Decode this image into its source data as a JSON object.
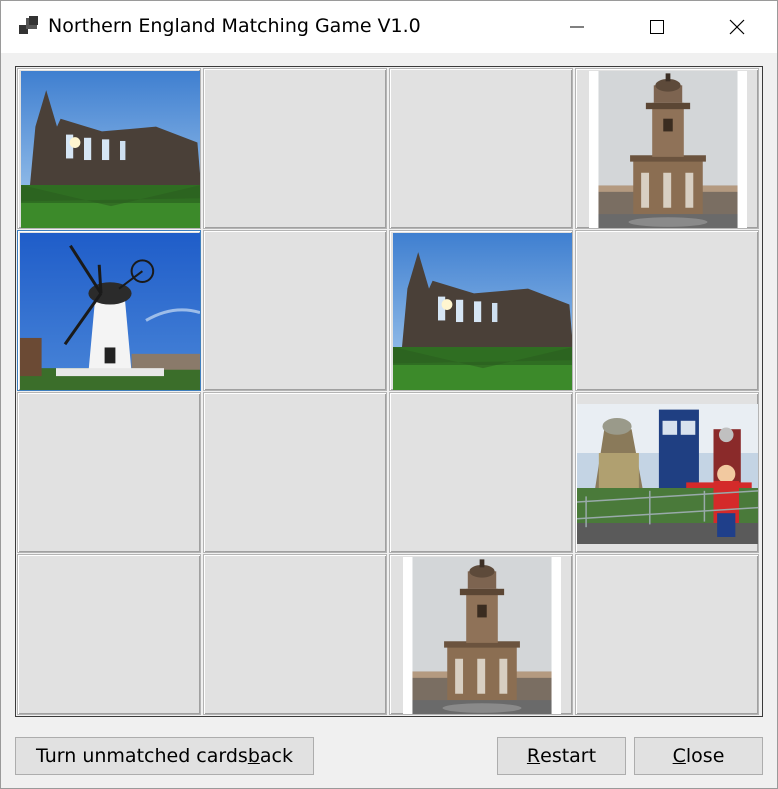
{
  "window": {
    "title": "Northern England Matching Game V1.0",
    "controls": [
      "minimize",
      "maximize",
      "close"
    ]
  },
  "board": {
    "cards": [
      {
        "image": "abbey-ruins",
        "face_up": true,
        "selected": false
      },
      {
        "image": null,
        "face_up": false
      },
      {
        "image": null,
        "face_up": false
      },
      {
        "image": "lighthouse",
        "face_up": true,
        "selected": false
      },
      {
        "image": "windmill",
        "face_up": true,
        "selected": true
      },
      {
        "image": null,
        "face_up": false
      },
      {
        "image": "abbey-ruins",
        "face_up": true,
        "selected": false
      },
      {
        "image": null,
        "face_up": false
      },
      {
        "image": null,
        "face_up": false
      },
      {
        "image": null,
        "face_up": false
      },
      {
        "image": null,
        "face_up": false
      },
      {
        "image": "daleks-tardis",
        "face_up": true,
        "selected": false
      },
      {
        "image": null,
        "face_up": false
      },
      {
        "image": null,
        "face_up": false
      },
      {
        "image": "lighthouse",
        "face_up": true,
        "selected": false
      },
      {
        "image": null,
        "face_up": false
      }
    ]
  },
  "buttons": {
    "turn_back": {
      "pre": "Turn unmatched cards ",
      "u": "b",
      "post": "ack"
    },
    "restart": {
      "pre": "",
      "u": "R",
      "post": "estart"
    },
    "close": {
      "pre": "",
      "u": "C",
      "post": "lose"
    }
  },
  "colors": {
    "card_back": "#e1e1e1",
    "selection_border": "#3f7fbf",
    "window_bg": "#f0f0f0"
  }
}
